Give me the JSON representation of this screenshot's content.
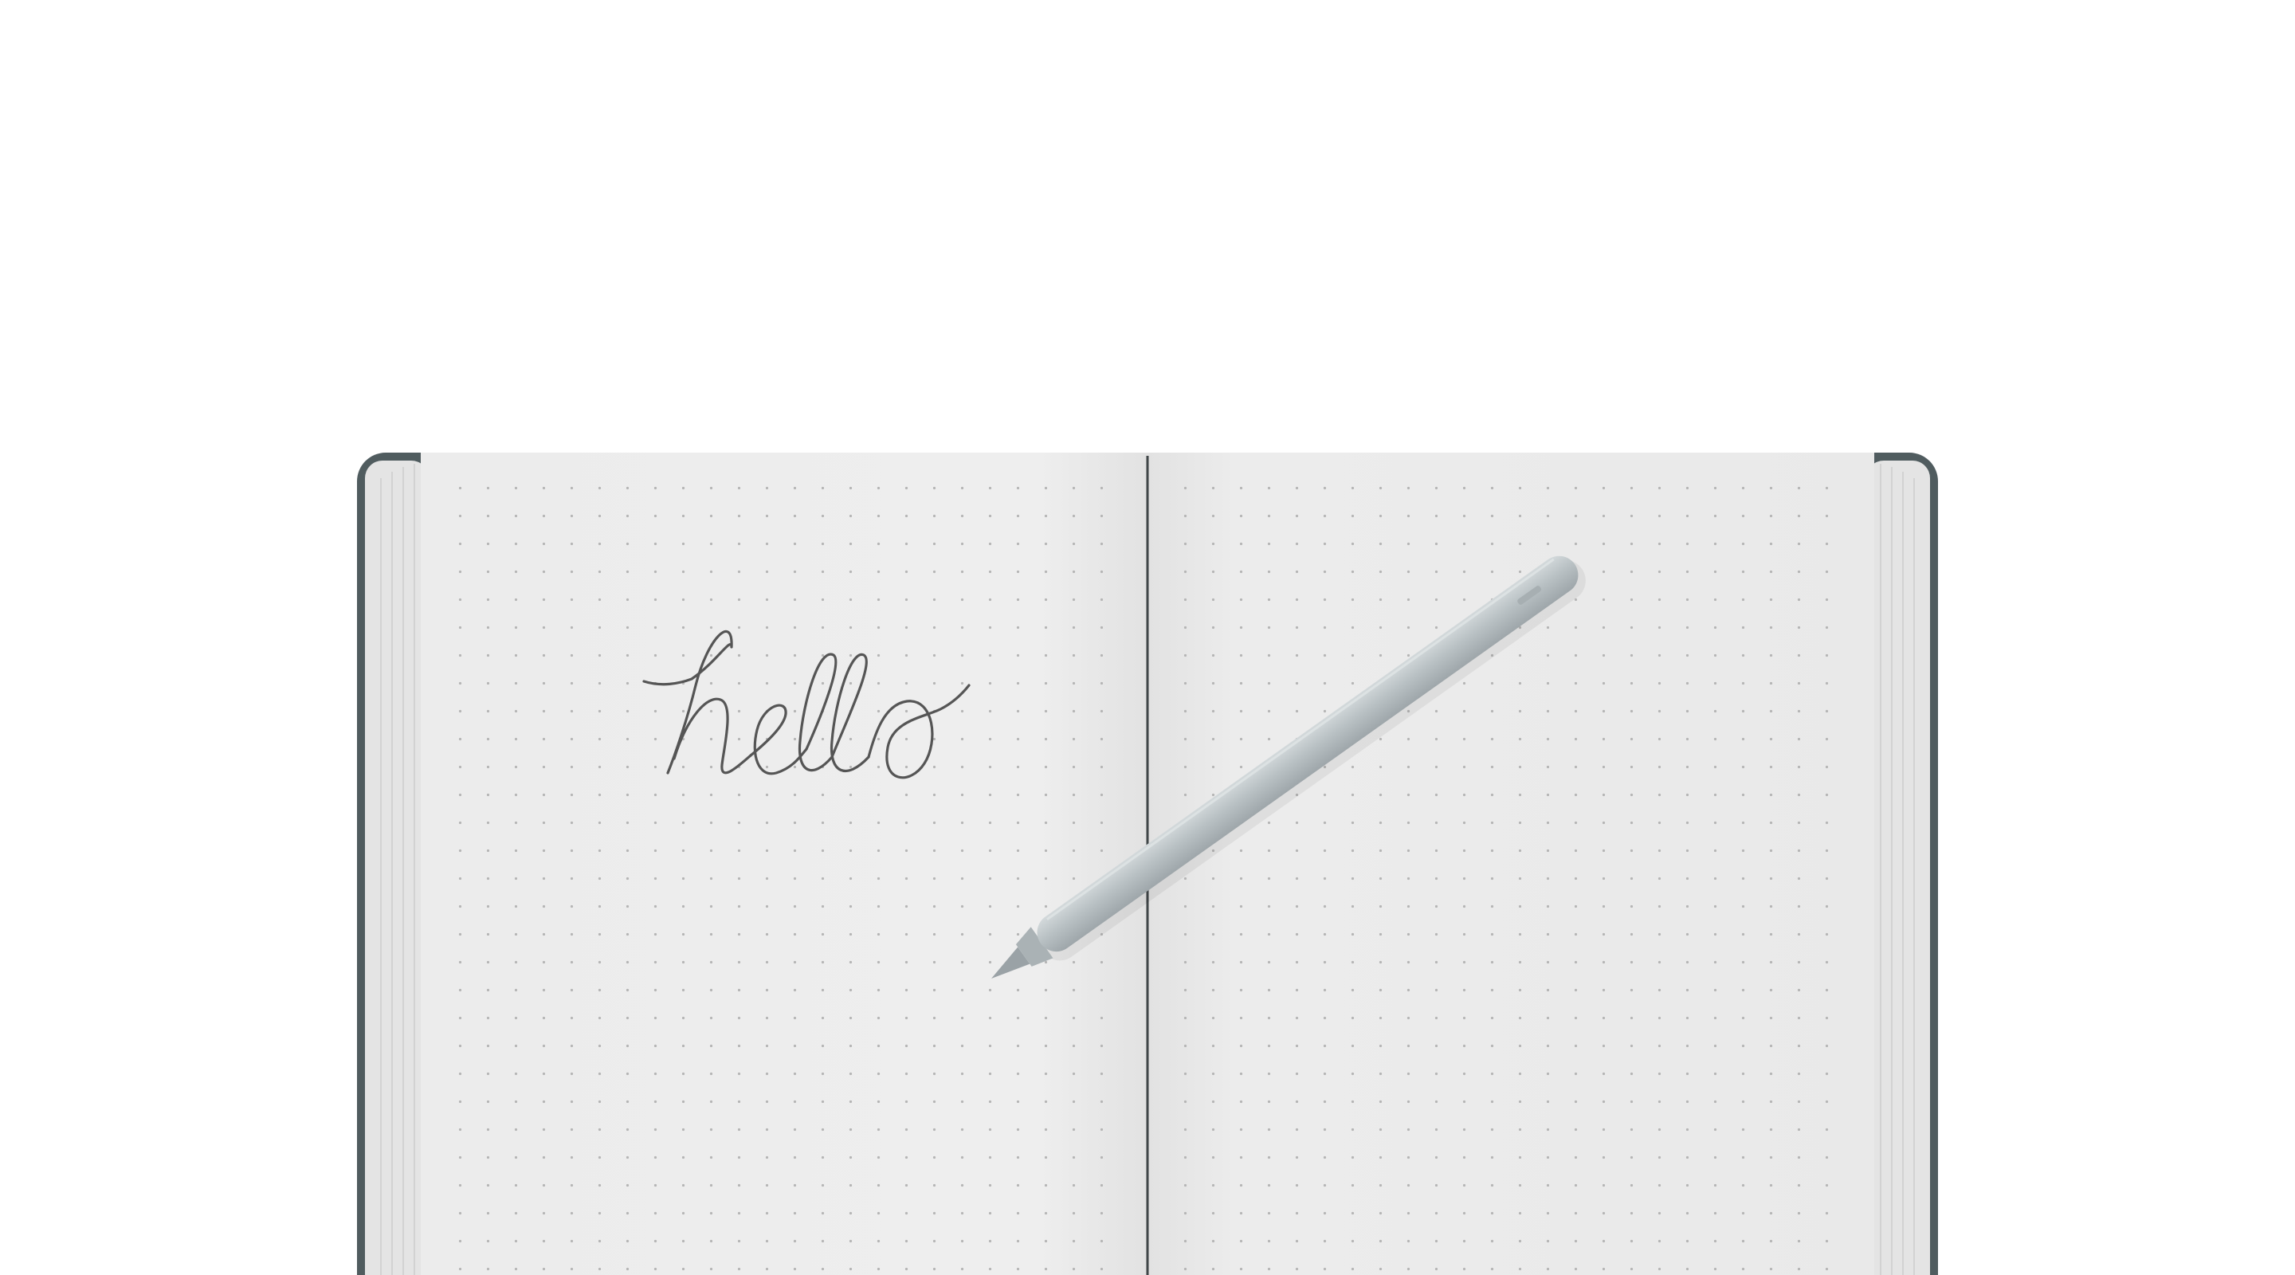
{
  "scene": {
    "background": "#ffffff",
    "notebook": {
      "cover_color": "#505c5f",
      "page_color": "#ededed",
      "dot_color": "#b5b5b5",
      "spine_line_color": "#404648"
    },
    "handwriting": {
      "text": "hello",
      "ink_color": "#555555"
    },
    "pencil": {
      "body_color": "#b9c1c4",
      "tip_color": "#9aa2a6"
    }
  }
}
